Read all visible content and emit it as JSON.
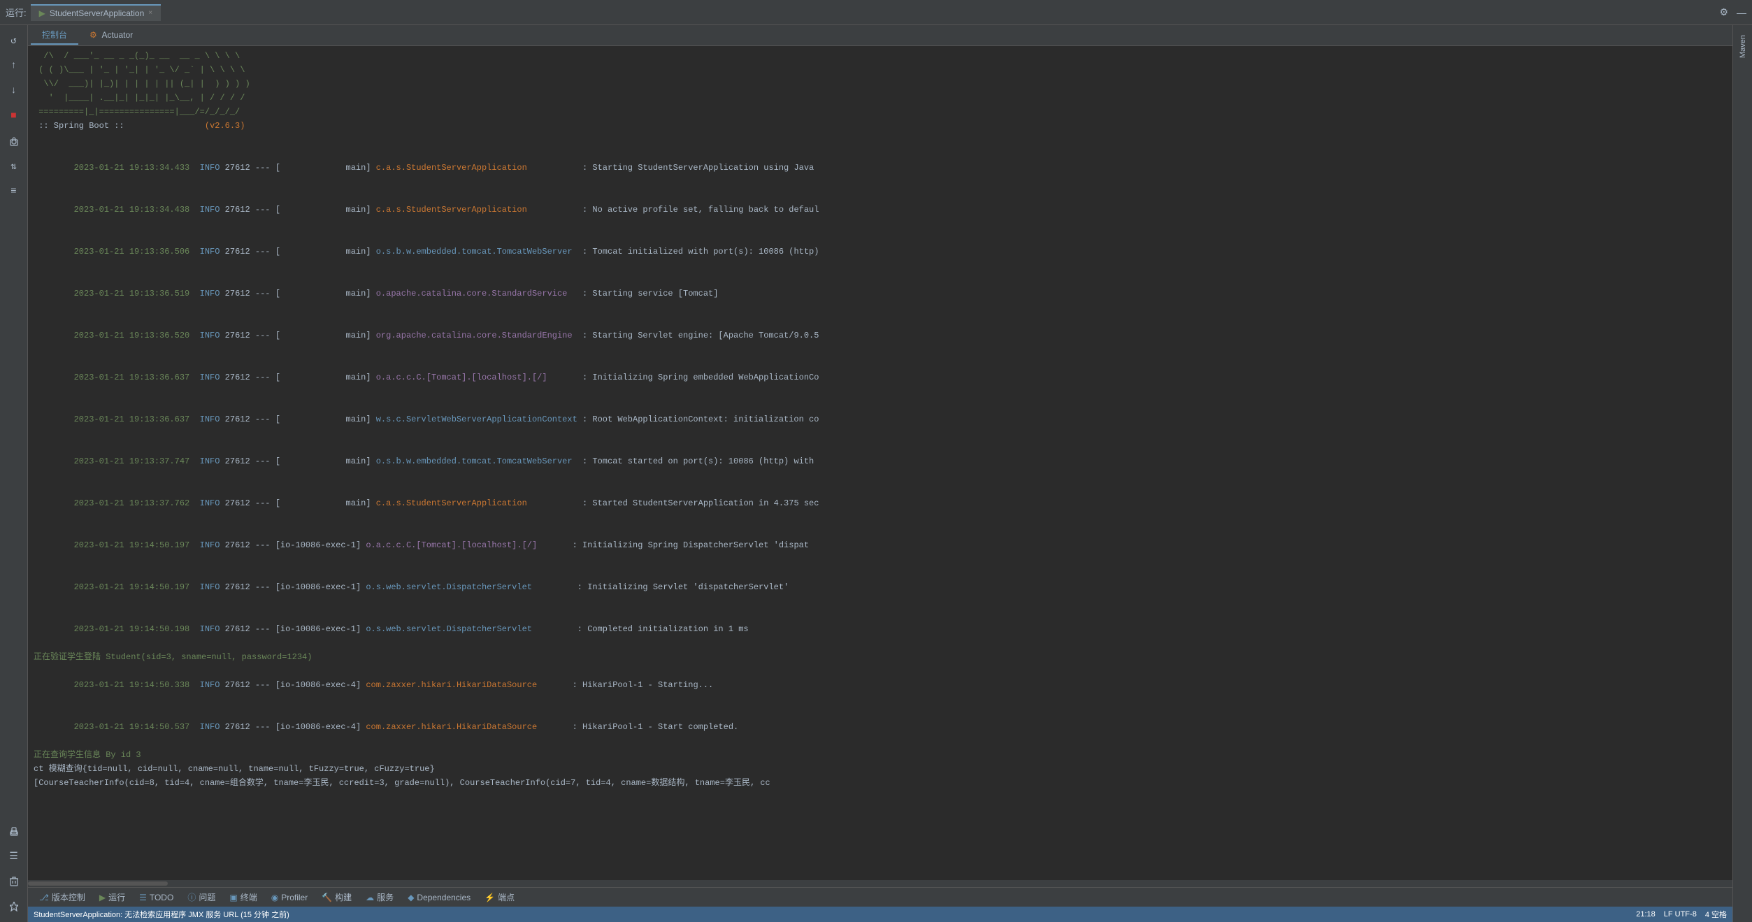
{
  "topbar": {
    "run_label": "运行:",
    "tab_label": "StudentServerApplication",
    "close_icon": "×",
    "settings_icon": "⚙",
    "minimize_icon": "—"
  },
  "run_tabs": [
    {
      "label": "控制台",
      "active": true
    },
    {
      "label": "Actuator",
      "active": false
    }
  ],
  "sidebar_buttons": [
    {
      "id": "restart",
      "icon": "↺"
    },
    {
      "id": "up",
      "icon": "↑"
    },
    {
      "id": "down",
      "icon": "↓"
    },
    {
      "id": "stop",
      "icon": "■",
      "color": "red"
    },
    {
      "id": "camera",
      "icon": "📷"
    },
    {
      "id": "sort",
      "icon": "⇅"
    },
    {
      "id": "local",
      "icon": "≡"
    },
    {
      "id": "print",
      "icon": "🖨"
    },
    {
      "id": "settings2",
      "icon": "☰"
    },
    {
      "id": "trash",
      "icon": "🗑"
    },
    {
      "id": "pin",
      "icon": "📌"
    }
  ],
  "console_lines": [
    {
      "type": "ascii",
      "text": "  /\\  / ___'_ __ _ _(_)_ __  __ _ \\ \\ \\ \\"
    },
    {
      "type": "ascii",
      "text": " ( ( )\\___ | '_ | '_| | '_ \\/ _` | \\ \\ \\ \\"
    },
    {
      "type": "ascii",
      "text": "  \\\\/  ___)| |_)| | | | | || (_| |  ) ) ) )"
    },
    {
      "type": "ascii",
      "text": "   '  |____| .__|_| |_|_| |_\\__, | / / / /"
    },
    {
      "type": "ascii",
      "text": " =========|_|===============|___/=/_/_/_/"
    },
    {
      "type": "spring",
      "text": " :: Spring Boot ::                (v2.6.3)"
    },
    {
      "type": "blank",
      "text": ""
    },
    {
      "type": "log",
      "ts": "2023-01-21 19:13:34.433",
      "level": "INFO",
      "pid": "27612",
      "thread": "main",
      "logger": "c.a.s.StudentServerApplication",
      "logger_type": "app",
      "msg": ": Starting StudentServerApplication using Java"
    },
    {
      "type": "log",
      "ts": "2023-01-21 19:13:34.438",
      "level": "INFO",
      "pid": "27612",
      "thread": "main",
      "logger": "c.a.s.StudentServerApplication",
      "logger_type": "app",
      "msg": ": No active profile set, falling back to defaul"
    },
    {
      "type": "log",
      "ts": "2023-01-21 19:13:36.506",
      "level": "INFO",
      "pid": "27612",
      "thread": "main",
      "logger": "o.s.b.w.embedded.tomcat.TomcatWebServer",
      "logger_type": "other",
      "msg": ": Tomcat initialized with port(s): 10086 (http)"
    },
    {
      "type": "log",
      "ts": "2023-01-21 19:13:36.519",
      "level": "INFO",
      "pid": "27612",
      "thread": "main",
      "logger": "o.apache.catalina.core.StandardService",
      "logger_type": "std",
      "msg": ": Starting service [Tomcat]"
    },
    {
      "type": "log",
      "ts": "2023-01-21 19:13:36.520",
      "level": "INFO",
      "pid": "27612",
      "thread": "main",
      "logger": "org.apache.catalina.core.StandardEngine",
      "logger_type": "std",
      "msg": ": Starting Servlet engine: [Apache Tomcat/9.0.5"
    },
    {
      "type": "log",
      "ts": "2023-01-21 19:13:36.637",
      "level": "INFO",
      "pid": "27612",
      "thread": "main",
      "logger": "o.a.c.c.C.[Tomcat].[localhost].[/]",
      "logger_type": "std",
      "msg": ": Initializing Spring embedded WebApplicationCo"
    },
    {
      "type": "log",
      "ts": "2023-01-21 19:13:36.637",
      "level": "INFO",
      "pid": "27612",
      "thread": "main",
      "logger": "w.s.c.ServletWebServerApplicationContext",
      "logger_type": "other",
      "msg": ": Root WebApplicationContext: initialization co"
    },
    {
      "type": "log",
      "ts": "2023-01-21 19:13:37.747",
      "level": "INFO",
      "pid": "27612",
      "thread": "main",
      "logger": "o.s.b.w.embedded.tomcat.TomcatWebServer",
      "logger_type": "other",
      "msg": ": Tomcat started on port(s): 10086 (http) with"
    },
    {
      "type": "log",
      "ts": "2023-01-21 19:13:37.762",
      "level": "INFO",
      "pid": "27612",
      "thread": "main",
      "logger": "c.a.s.StudentServerApplication",
      "logger_type": "app",
      "msg": ": Started StudentServerApplication in 4.375 sec"
    },
    {
      "type": "log",
      "ts": "2023-01-21 19:14:50.197",
      "level": "INFO",
      "pid": "27612",
      "thread": "io-10086-exec-1",
      "logger": "o.a.c.c.C.[Tomcat].[localhost].[/]",
      "logger_type": "std",
      "msg": ": Initializing Spring DispatcherServlet 'dispat"
    },
    {
      "type": "log",
      "ts": "2023-01-21 19:14:50.197",
      "level": "INFO",
      "pid": "27612",
      "thread": "io-10086-exec-1",
      "logger": "o.s.web.servlet.DispatcherServlet",
      "logger_type": "other",
      "msg": ": Initializing Servlet 'dispatcherServlet'"
    },
    {
      "type": "log",
      "ts": "2023-01-21 19:14:50.198",
      "level": "INFO",
      "pid": "27612",
      "thread": "io-10086-exec-1",
      "logger": "o.s.web.servlet.DispatcherServlet",
      "logger_type": "other",
      "msg": ": Completed initialization in 1 ms"
    },
    {
      "type": "chinese",
      "text": "正在验证学生登陆 Student(sid=3, sname=null, password=1234)"
    },
    {
      "type": "log",
      "ts": "2023-01-21 19:14:50.338",
      "level": "INFO",
      "pid": "27612",
      "thread": "io-10086-exec-4",
      "logger": "com.zaxxer.hikari.HikariDataSource",
      "logger_type": "hikari",
      "msg": ": HikariPool-1 - Starting..."
    },
    {
      "type": "log",
      "ts": "2023-01-21 19:14:50.537",
      "level": "INFO",
      "pid": "27612",
      "thread": "io-10086-exec-4",
      "logger": "com.zaxxer.hikari.HikariDataSource",
      "logger_type": "hikari",
      "msg": ": HikariPool-1 - Start completed."
    },
    {
      "type": "chinese",
      "text": "正在查询学生信息 By id 3"
    },
    {
      "type": "plain",
      "text": "ct 模糊查询{tid=null, cid=null, cname=null, tname=null, tFuzzy=true, cFuzzy=true}"
    },
    {
      "type": "plain",
      "text": "[CourseTeacherInfo(cid=8, tid=4, cname=组合数学, tname=李玉民, ccredit=3, grade=null), CourseTeacherInfo(cid=7, tid=4, cname=数据结构, tname=李玉民, cc"
    }
  ],
  "bottom_toolbar": {
    "buttons": [
      {
        "id": "version-control",
        "icon": "⎇",
        "label": "版本控制"
      },
      {
        "id": "run",
        "icon": "▶",
        "label": "运行",
        "is_run": true
      },
      {
        "id": "todo",
        "icon": "☰",
        "label": "TODO"
      },
      {
        "id": "problems",
        "icon": "ⓘ",
        "label": "问题"
      },
      {
        "id": "terminal",
        "icon": "▣",
        "label": "终端"
      },
      {
        "id": "profiler",
        "icon": "◉",
        "label": "Profiler"
      },
      {
        "id": "build",
        "icon": "🔨",
        "label": "构建"
      },
      {
        "id": "services",
        "icon": "☁",
        "label": "服务"
      },
      {
        "id": "dependencies",
        "icon": "◆",
        "label": "Dependencies"
      },
      {
        "id": "endpoints",
        "icon": "⚡",
        "label": "端点"
      }
    ]
  },
  "status_bar": {
    "status_text": "StudentServerApplication: 无法检索应用程序 JMX 服务 URL (15 分钟 之前)",
    "time": "21:18",
    "encoding": "LF  UTF-8",
    "indent": "4 空格"
  },
  "right_sidebar": {
    "label": "Maven"
  }
}
